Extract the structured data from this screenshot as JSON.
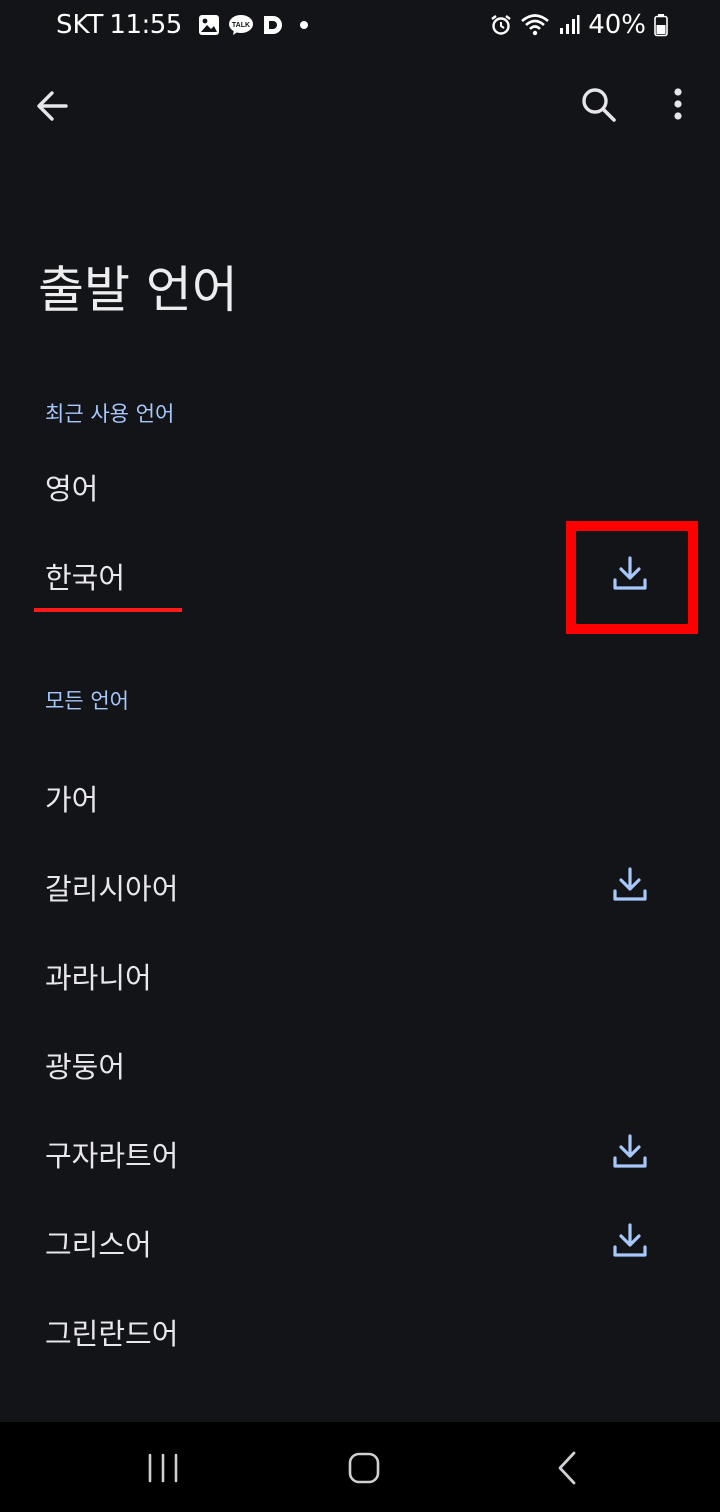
{
  "status": {
    "carrier": "SKT",
    "time": "11:55",
    "battery": "40%",
    "icons_left": [
      "gallery-icon",
      "kakaotalk-icon",
      "d-app-icon",
      "dot-icon"
    ],
    "icons_right": [
      "alarm-icon",
      "wifi-icon",
      "signal-icon",
      "battery-icon"
    ]
  },
  "appbar": {
    "icons": [
      "back-arrow-icon",
      "search-icon",
      "more-vert-icon"
    ]
  },
  "page": {
    "title": "출발 언어"
  },
  "sections": {
    "recent": {
      "label": "최근 사용 언어",
      "items": [
        {
          "label": "영어",
          "downloadable": false
        },
        {
          "label": "한국어",
          "downloadable": true
        }
      ]
    },
    "all": {
      "label": "모든 언어",
      "items": [
        {
          "label": "가어",
          "downloadable": false
        },
        {
          "label": "갈리시아어",
          "downloadable": true
        },
        {
          "label": "과라니어",
          "downloadable": false
        },
        {
          "label": "광둥어",
          "downloadable": false
        },
        {
          "label": "구자라트어",
          "downloadable": true
        },
        {
          "label": "그리스어",
          "downloadable": true
        },
        {
          "label": "그린란드어",
          "downloadable": false
        }
      ]
    }
  },
  "colors": {
    "background": "#131418",
    "accent": "#a8c7fa",
    "highlight": "#ff0000"
  },
  "navbar": {
    "icons": [
      "recents-icon",
      "home-icon",
      "nav-back-icon"
    ]
  }
}
